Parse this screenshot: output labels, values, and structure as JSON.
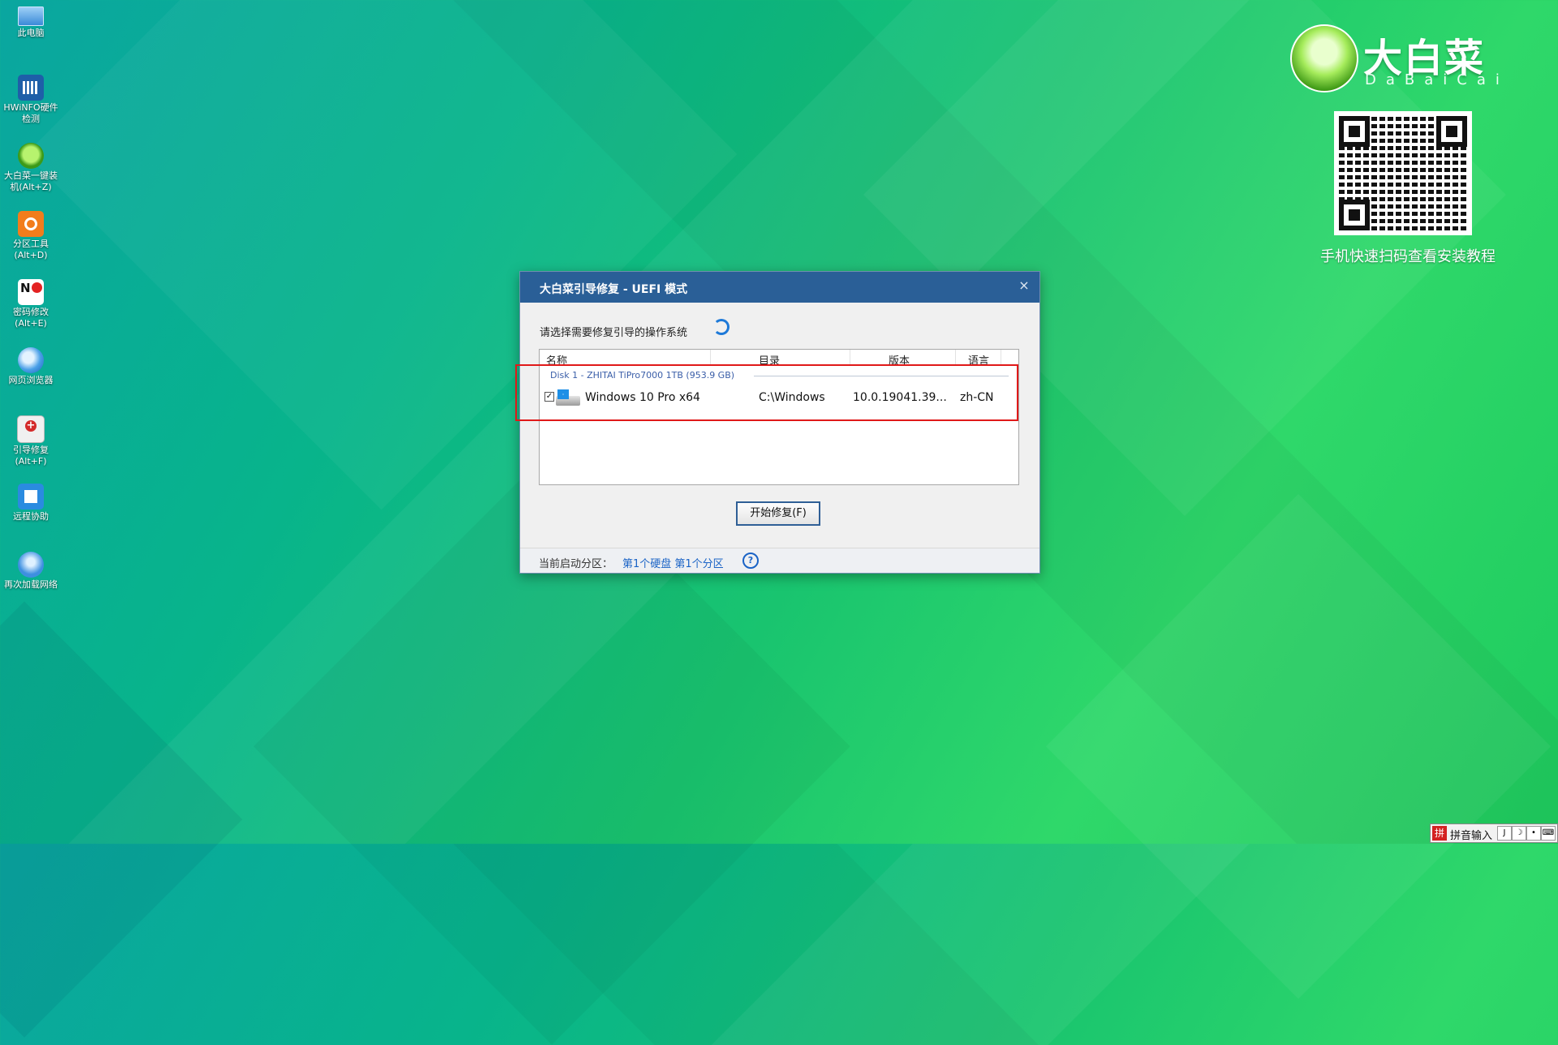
{
  "desktop": {
    "icons": [
      {
        "label": "此电脑",
        "icon": "computer-icon"
      },
      {
        "label": "HWiNFO硬件检测",
        "icon": "hwinfo-icon"
      },
      {
        "label": "大白菜一键装机(Alt+Z)",
        "icon": "dabaicai-installer-icon"
      },
      {
        "label": "分区工具(Alt+D)",
        "icon": "partition-tool-icon"
      },
      {
        "label": "密码修改(Alt+E)",
        "icon": "password-change-icon"
      },
      {
        "label": "网页浏览器",
        "icon": "web-browser-icon"
      },
      {
        "label": "引导修复(Alt+F)",
        "icon": "boot-repair-icon"
      },
      {
        "label": "远程协助",
        "icon": "remote-assist-icon"
      },
      {
        "label": "再次加载网络",
        "icon": "reload-network-icon"
      }
    ]
  },
  "brand": {
    "name_cn": "大白菜",
    "name_en": "DaBaiCai",
    "qr_caption": "手机快速扫码查看安装教程"
  },
  "dialog": {
    "title": "大白菜引导修复 - UEFI 模式",
    "close": "×",
    "prompt": "请选择需要修复引导的操作系统",
    "columns": [
      "名称",
      "目录",
      "版本",
      "语言"
    ],
    "group": "Disk 1 - ZHITAI TiPro7000 1TB (953.9 GB)",
    "rows": [
      {
        "checked": "✓",
        "name": "Windows 10 Pro x64",
        "dir": "C:\\Windows",
        "version": "10.0.19041.39...",
        "lang": "zh-CN"
      }
    ],
    "start_button": "开始修复(F)",
    "footer_label": "当前启动分区：",
    "footer_link": "第1个硬盘 第1个分区",
    "help": "?"
  },
  "ime": {
    "logo": "拼",
    "label": "拼音输入",
    "btn1": "J",
    "btn2": "☽",
    "btn3": "•",
    "btn4": "⌨"
  },
  "colors": {
    "titlebar": "#2a5f97",
    "highlight": "#e01919",
    "link": "#1a63c6"
  }
}
